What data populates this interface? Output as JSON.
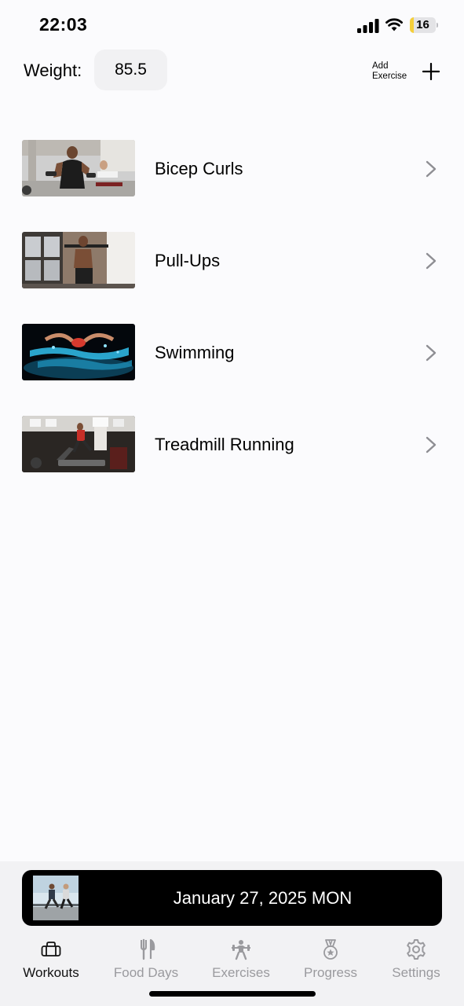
{
  "status_bar": {
    "time": "22:03",
    "battery_level": 16,
    "battery_color": "#F5CF3A"
  },
  "header": {
    "weight_label": "Weight:",
    "weight_value": "85.5",
    "add_exercise_label": "Add\nExercise",
    "add_icon": "plus-icon"
  },
  "exercises": [
    {
      "name": "Bicep Curls",
      "image": "gym-dumbbell-photo"
    },
    {
      "name": "Pull-Ups",
      "image": "gym-barbell-photo"
    },
    {
      "name": "Swimming",
      "image": "swimmer-photo"
    },
    {
      "name": "Treadmill Running",
      "image": "treadmill-photo"
    }
  ],
  "date_bar": {
    "date": "January 27, 2025 MON",
    "image": "runners-photo"
  },
  "tabs": [
    {
      "label": "Workouts",
      "icon": "gym-bag-icon",
      "active": true
    },
    {
      "label": "Food Days",
      "icon": "fork-knife-icon",
      "active": false
    },
    {
      "label": "Exercises",
      "icon": "weightlifter-icon",
      "active": false
    },
    {
      "label": "Progress",
      "icon": "medal-icon",
      "active": false
    },
    {
      "label": "Settings",
      "icon": "gear-icon",
      "active": false
    }
  ],
  "colors": {
    "background": "#FBFBFD",
    "active_tab": "#111111",
    "inactive_tab": "#9A9A9E",
    "date_bar": "#000000"
  }
}
